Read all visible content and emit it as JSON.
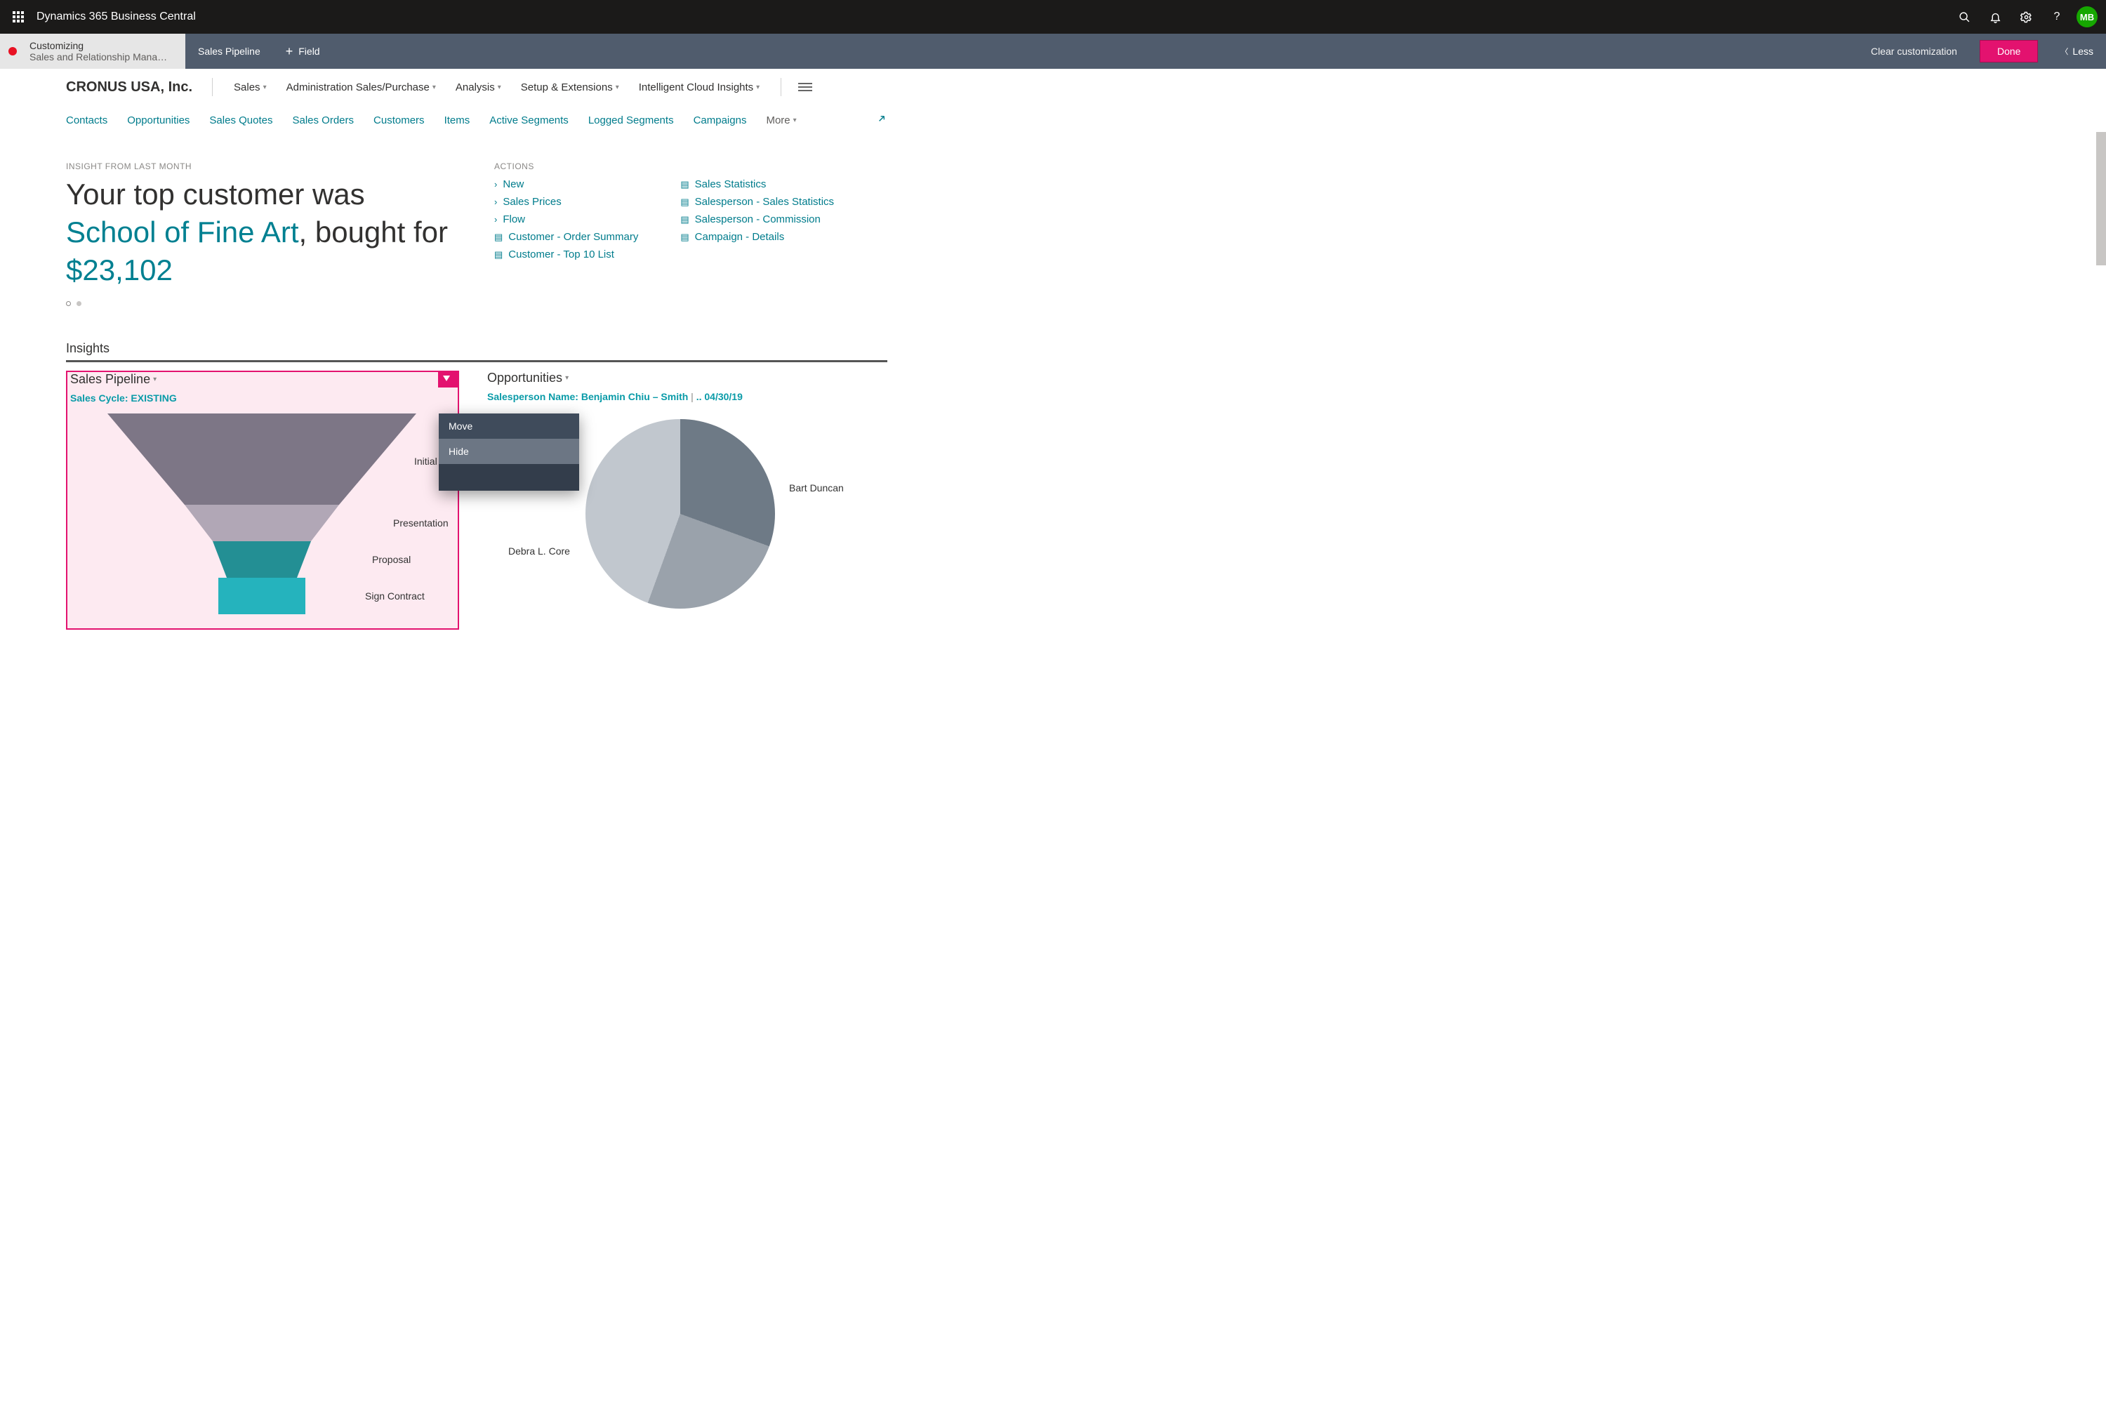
{
  "topbar": {
    "app_title": "Dynamics 365 Business Central",
    "avatar_initials": "MB"
  },
  "custbar": {
    "status_line1": "Customizing",
    "status_line2": "Sales and Relationship Mana…",
    "tab_sales_pipeline": "Sales Pipeline",
    "add_field": "Field",
    "clear": "Clear customization",
    "done": "Done",
    "less": "Less"
  },
  "company_name": "CRONUS USA, Inc.",
  "menu1": {
    "sales": "Sales",
    "admin": "Administration Sales/Purchase",
    "analysis": "Analysis",
    "setup": "Setup & Extensions",
    "insights": "Intelligent Cloud Insights"
  },
  "menu2": {
    "contacts": "Contacts",
    "opportunities": "Opportunities",
    "quotes": "Sales Quotes",
    "orders": "Sales Orders",
    "customers": "Customers",
    "items": "Items",
    "active_segments": "Active Segments",
    "logged_segments": "Logged Segments",
    "campaigns": "Campaigns",
    "more": "More"
  },
  "insight": {
    "caption": "INSIGHT FROM LAST MONTH",
    "line1": "Your top customer was ",
    "customer": "School of Fine Art",
    "line2a": ", bought for ",
    "amount": "$23,102"
  },
  "actions": {
    "caption": "ACTIONS",
    "col1": {
      "new": "New",
      "sales_prices": "Sales Prices",
      "flow": "Flow",
      "cust_order_summary": "Customer - Order Summary",
      "cust_top10": "Customer - Top 10 List"
    },
    "col2": {
      "sales_stats": "Sales Statistics",
      "sp_stats": "Salesperson - Sales Statistics",
      "sp_commission": "Salesperson - Commission",
      "campaign_details": "Campaign - Details"
    }
  },
  "insights_section_title": "Insights",
  "pipeline_card": {
    "title": "Sales Pipeline",
    "subtitle_label": "Sales Cycle: ",
    "subtitle_value": "EXISTING"
  },
  "opportunities_card": {
    "title": "Opportunities",
    "sub_person": "Salesperson Name: Benjamin Chiu – Smith",
    "sub_sep": " | ",
    "sub_date": " .. 04/30/19"
  },
  "ctxmenu": {
    "move": "Move",
    "hide": "Hide"
  },
  "pie_labels": {
    "a": "Bart Duncan",
    "b": "Debra L. Core"
  },
  "chart_data": [
    {
      "type": "funnel",
      "title": "Sales Pipeline",
      "subtitle": "Sales Cycle: EXISTING",
      "stages": [
        {
          "name": "Initial",
          "width_pct": 100,
          "color": "#7d7686"
        },
        {
          "name": "Presentation",
          "width_pct": 58,
          "color": "#b1a7b6"
        },
        {
          "name": "Proposal",
          "width_pct": 38,
          "color": "#238f94"
        },
        {
          "name": "Sign Contract",
          "width_pct": 30,
          "color": "#25b3bd"
        }
      ]
    },
    {
      "type": "pie",
      "title": "Opportunities",
      "subtitle": "Salesperson Name: Benjamin Chiu – Smith |  .. 04/30/19",
      "series": [
        {
          "name": "Bart Duncan",
          "value": 31,
          "color": "#6e7a86"
        },
        {
          "name": "(unlabeled)",
          "value": 25,
          "color": "#9aa2ab"
        },
        {
          "name": "Debra L. Core",
          "value": 44,
          "color": "#c1c7ce"
        }
      ]
    }
  ]
}
